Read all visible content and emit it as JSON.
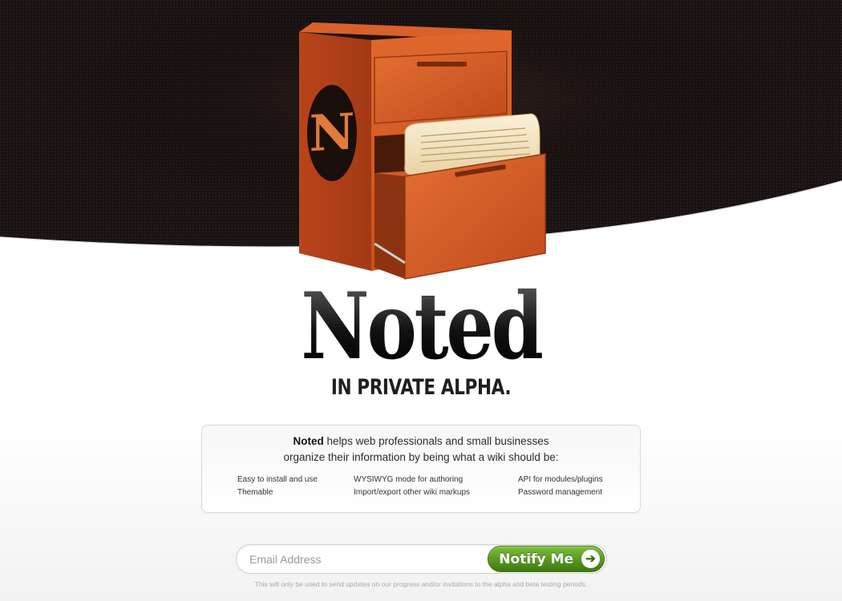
{
  "hero": {
    "logo_letter": "N",
    "colors": {
      "cabinet": "#c9501e",
      "background": "#161010"
    }
  },
  "brand": {
    "title": "Noted",
    "tagline": "IN PRIVATE ALPHA."
  },
  "intro": {
    "brand_name": "Noted",
    "line1": "helps web professionals and small businesses",
    "line2": "organize their information by being what a wiki should be:"
  },
  "features": [
    "Easy to install and use",
    "WYSIWYG mode for authoring",
    "API for modules/plugins",
    "Themable",
    "Import/export other wiki markups",
    "Password management"
  ],
  "signup": {
    "email_placeholder": "Email Address",
    "email_value": "",
    "button_label": "Notify Me",
    "button_icon": "arrow-right-icon",
    "button_color": "#5a9a22",
    "disclaimer": "This will only be used to send updates on our progress and/or invitations to the alpha and beta testing periods."
  }
}
